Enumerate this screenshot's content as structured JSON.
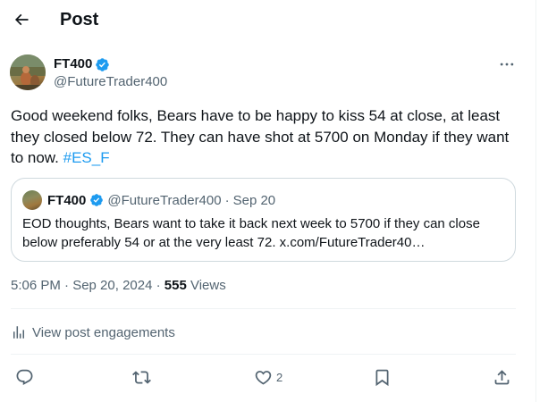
{
  "header": {
    "title": "Post"
  },
  "post": {
    "author_name": "FT400",
    "author_handle": "@FutureTrader400",
    "text_before": "Good weekend folks, Bears have to be happy to kiss 54 at close, at least they closed below 72.  They can have shot at 5700 on Monday if they want to now. ",
    "hashtag": "#ES_F",
    "timestamp": "5:06 PM · Sep 20, 2024 · ",
    "views_count": "555",
    "views_label": " Views"
  },
  "quote": {
    "author_name": "FT400",
    "author_handle": "@FutureTrader400",
    "separator": "·",
    "date": "Sep 20",
    "text": "EOD thoughts, Bears want to take it back next week to 5700 if they can close below preferably 54 or at the very least 72. x.com/FutureTrader40…"
  },
  "engagements": {
    "label": "View post engagements"
  },
  "actions": {
    "like_count": "2"
  },
  "icons": {
    "back": "arrow-left-icon",
    "verified": "verified-badge-icon",
    "more": "more-horizontal-icon",
    "analytics": "bar-chart-icon",
    "reply": "reply-icon",
    "retweet": "retweet-icon",
    "like": "heart-icon",
    "bookmark": "bookmark-icon",
    "share": "share-icon"
  },
  "colors": {
    "accent": "#1d9bf0",
    "text": "#0f1419",
    "secondary": "#536471",
    "border": "#cfd9de"
  }
}
